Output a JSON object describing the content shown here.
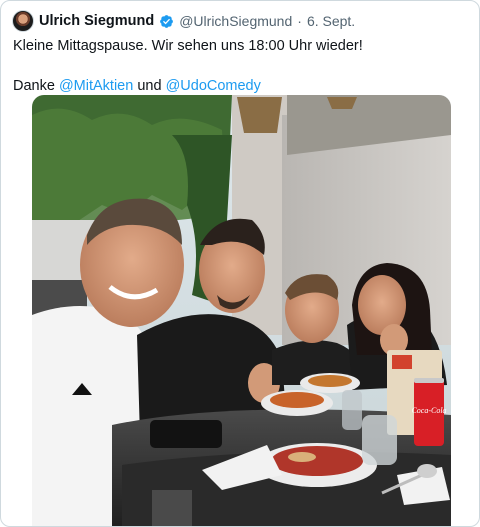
{
  "tweet": {
    "author_name": "Ulrich Siegmund",
    "author_handle": "@UlrichSiegmund",
    "separator": "·",
    "date": "6. Sept.",
    "text_line1": "Kleine Mittagspause. Wir sehen uns 18:00 Uhr wieder!",
    "text_line3_prefix": "Danke ",
    "mention1": "@MitAktien",
    "text_line3_middle": " und ",
    "mention2": "@UdoComedy",
    "verified_icon": "verified-badge-icon",
    "colors": {
      "mention": "#1d9bf0",
      "verified": "#1d9bf0",
      "secondary_text": "#536471"
    }
  },
  "photo": {
    "can_brand": "Coca-Cola"
  }
}
